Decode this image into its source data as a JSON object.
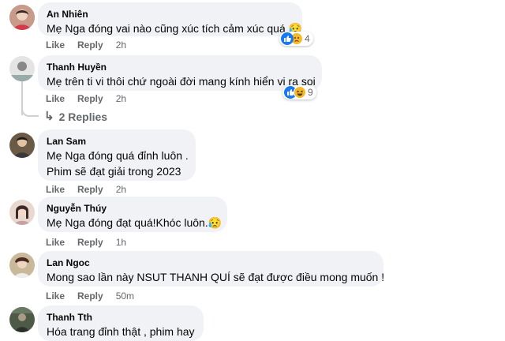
{
  "comments": [
    {
      "author": "An Nhiên",
      "text": [
        "Mẹ Nga đóng vai nào cũng xúc tích cảm xúc quá 😥"
      ],
      "like": "Like",
      "reply": "Reply",
      "time": "2h",
      "reactions": {
        "count": "4",
        "icons": [
          "like-icon",
          "sad-icon"
        ]
      }
    },
    {
      "author": "Thanh Huyền",
      "text": [
        "Mẹ trên ti vi thôi chứ ngoài đời mang kính hiển vi ra soi"
      ],
      "like": "Like",
      "reply": "Reply",
      "time": "2h",
      "reactions": {
        "count": "9",
        "icons": [
          "like-icon",
          "haha-icon"
        ]
      }
    },
    {
      "author": "Lan Sam",
      "text": [
        "Mẹ Nga đóng quá đỉnh luôn .",
        "Phim sẽ đạt giải trong 2023"
      ],
      "like": "Like",
      "reply": "Reply",
      "time": "2h"
    },
    {
      "author": "Nguyễn Thúy",
      "text": [
        "Mẹ Nga đóng đạt quá!Khóc luôn.😥"
      ],
      "like": "Like",
      "reply": "Reply",
      "time": "1h"
    },
    {
      "author": "Lan Ngoc",
      "text": [
        "Mong sao lần này NSUT THANH QUÍ sẽ đạt được điều mong muốn !"
      ],
      "like": "Like",
      "reply": "Reply",
      "time": "50m"
    },
    {
      "author": "Thanh Tth",
      "text": [
        "Hóa trang đỉnh thật , phim hay"
      ]
    }
  ],
  "replies_link": "2 Replies",
  "colors": {
    "bubble": "#f0f2f5",
    "meta": "#65676b",
    "like_blue": "#1877f2",
    "haha_yellow": "#f7b928"
  }
}
